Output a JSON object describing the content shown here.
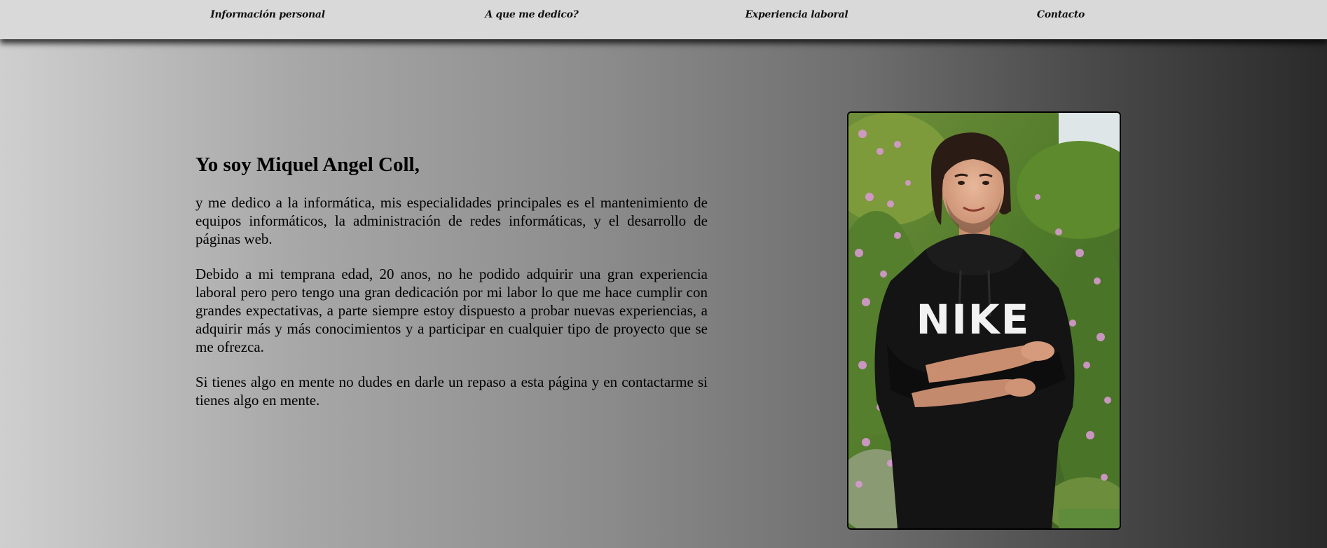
{
  "nav": {
    "items": [
      {
        "label": "Información personal"
      },
      {
        "label": "A que me dedico?"
      },
      {
        "label": "Experiencia laboral"
      },
      {
        "label": "Contacto"
      }
    ]
  },
  "intro": {
    "title": "Yo soy Miquel Angel Coll,",
    "paragraphs": [
      "y me dedico a la informática, mis especialidades principales es el mantenimiento de equipos informáticos, la administración de redes informáticas, y el desarrollo de páginas web.",
      "Debido a mi temprana edad, 20 anos, no he podido adquirir una gran experiencia laboral pero pero tengo una gran dedicación por mi labor lo que me hace cumplir con grandes expectativas, a parte siempre estoy dispuesto a probar nuevas experiencias, a adquirir más y más conocimientos y a participar en cualquier tipo de proyecto que se me ofrezca.",
      "Si tienes algo en mente no dudes en darle un repaso a esta página y en contactarme si tienes algo en mente."
    ]
  },
  "photo": {
    "hoodie_text": "NIKE"
  },
  "colors": {
    "navbar": "#d9d9d9",
    "gradient_start": "#cfcfcf",
    "gradient_end": "#2a2a2a",
    "text": "#000000"
  }
}
